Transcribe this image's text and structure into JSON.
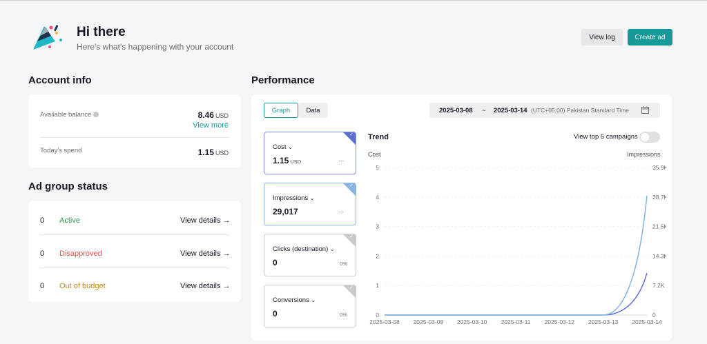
{
  "header": {
    "title": "Hi there",
    "subtitle": "Here's what's happening with your account",
    "view_log_label": "View log",
    "create_ad_label": "Create ad"
  },
  "account_info": {
    "title": "Account info",
    "balance_label": "Available balance",
    "balance_value": "8.46",
    "balance_unit": "USD",
    "view_more": "View more",
    "spend_label": "Today's spend",
    "spend_value": "1.15",
    "spend_unit": "USD"
  },
  "ad_group_status": {
    "title": "Ad group status",
    "rows": [
      {
        "count": "0",
        "label": "Active",
        "color": "#2e9b47",
        "action": "View details"
      },
      {
        "count": "0",
        "label": "Disapproved",
        "color": "#e0524c",
        "action": "View details"
      },
      {
        "count": "0",
        "label": "Out of budget",
        "color": "#c28a1c",
        "action": "View details"
      }
    ]
  },
  "performance": {
    "title": "Performance",
    "tabs": [
      "Graph",
      "Data"
    ],
    "active_tab": "Graph",
    "date_start": "2025-03-08",
    "date_sep": "~",
    "date_end": "2025-03-14",
    "timezone": "(UTC+05:00) Pakistan Standard Time",
    "metrics": [
      {
        "name": "Cost",
        "value": "1.15",
        "unit": "USD",
        "extra": "...",
        "selected": true,
        "color": "#5b6fd0"
      },
      {
        "name": "Impressions",
        "value": "29,017",
        "unit": "",
        "extra": "...",
        "selected": true,
        "color": "#7fb3e8"
      },
      {
        "name": "Clicks (destination)",
        "value": "0",
        "unit": "",
        "extra": "0%",
        "selected": false,
        "color": "#c9cbcf"
      },
      {
        "name": "Conversions",
        "value": "0",
        "unit": "",
        "extra": "0%",
        "selected": false,
        "color": "#c9cbcf"
      }
    ],
    "trend_title": "Trend",
    "top5_label": "View top 5 campaigns",
    "top5_enabled": false
  },
  "chart_data": {
    "type": "line",
    "xlabel": "",
    "ylabel_left": "Cost",
    "ylabel_right": "Impressions",
    "categories": [
      "2025-03-08",
      "2025-03-09",
      "2025-03-10",
      "2025-03-11",
      "2025-03-12",
      "2025-03-13",
      "2025-03-14"
    ],
    "y_left_ticks": [
      "0",
      "1",
      "2",
      "3",
      "4",
      "5"
    ],
    "y_left_lim": [
      0,
      5
    ],
    "y_right_ticks": [
      "0",
      "7.2K",
      "14.3K",
      "21.5K",
      "28.7K",
      "35.9K"
    ],
    "y_right_lim": [
      0,
      35900
    ],
    "grid": true,
    "series": [
      {
        "name": "Cost",
        "axis": "left",
        "color": "#5b6fd0",
        "values": [
          0,
          0,
          0,
          0,
          0,
          0,
          1.42
        ]
      },
      {
        "name": "Impressions",
        "axis": "right",
        "color": "#7fb3e8",
        "values": [
          0,
          0,
          0,
          0,
          0,
          0,
          29017
        ]
      }
    ]
  }
}
